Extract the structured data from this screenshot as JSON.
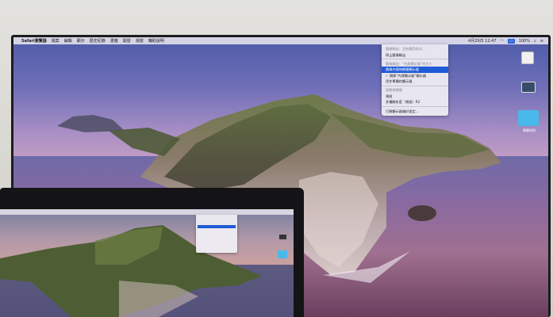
{
  "menubar": {
    "apple": "",
    "items": [
      "Safari瀏覽器",
      "檔案",
      "編輯",
      "顯示",
      "歷史紀錄",
      "書籤",
      "開發",
      "視窗",
      "輔助說明"
    ],
    "clock": "4月29日 12:47",
    "battery": "100%"
  },
  "display_menu": {
    "items": [
      {
        "label": "鏡像輸出：沒有應用程式...",
        "type": "head"
      },
      {
        "label": "停止鏡像輸出",
        "type": "item"
      },
      {
        "label": "鏡像輸出：“內建顯示器”的大小",
        "type": "head"
      },
      {
        "label": "鏡像內建視網膜顯示器",
        "type": "highlight"
      },
      {
        "label": "鏡像“內建顯示器”顯示器",
        "type": "check"
      },
      {
        "label": "用作單獨的顯示器",
        "type": "item"
      },
      {
        "label": "調整視網膜",
        "type": "head"
      },
      {
        "label": "預設",
        "type": "item"
      },
      {
        "label": "多種解析度（預設）R2",
        "type": "item"
      },
      {
        "label": "打開顯示器偏好設定...",
        "type": "item"
      }
    ]
  },
  "desktop_icons": [
    {
      "label": ""
    },
    {
      "label": ""
    },
    {
      "label": "螢幕快照"
    }
  ],
  "colors": {
    "highlight": "#1f5bd6",
    "menubar_bg": "#e1deeb"
  }
}
